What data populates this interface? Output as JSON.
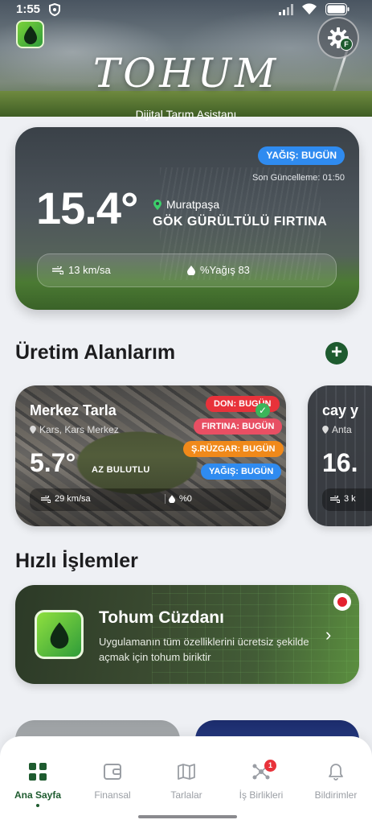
{
  "status_bar": {
    "time": "1:55"
  },
  "header": {
    "brand": "TOHUM",
    "subtitle": "Dijital Tarım Asistanı",
    "settings_badge": "F"
  },
  "weather": {
    "rain_pill": "YAĞIŞ: BUGÜN",
    "last_update": "Son Güncelleme: 01:50",
    "temperature": "15.4°",
    "location": "Muratpaşa",
    "condition": "GÖK GÜRÜLTÜLÜ FIRTINA",
    "wind": "13 km/sa",
    "rain": "%Yağış 83"
  },
  "fields_section": {
    "title": "Üretim Alanlarım"
  },
  "fields": [
    {
      "name": "Merkez Tarla",
      "location": "Kars, Kars Merkez",
      "temperature": "5.7°",
      "condition": "AZ BULUTLU",
      "wind": "29 km/sa",
      "rain": "%0",
      "alerts": [
        "DON: BUGÜN",
        "FIRTINA: BUGÜN",
        "Ş.RÜZGAR: BUGÜN",
        "YAĞIŞ: BUGÜN"
      ]
    },
    {
      "name": "cay y",
      "location": "Anta",
      "temperature": "16.",
      "wind": "3 k"
    }
  ],
  "quick_actions": {
    "title": "Hızlı İşlemler"
  },
  "wallet": {
    "title": "Tohum Cüzdanı",
    "description": "Uygulamanın tüm özelliklerini ücretsiz şekilde açmak için tohum biriktir"
  },
  "nav": {
    "items": [
      {
        "label": "Ana Sayfa",
        "icon": "grid-icon"
      },
      {
        "label": "Finansal",
        "icon": "wallet-icon"
      },
      {
        "label": "Tarlalar",
        "icon": "map-icon"
      },
      {
        "label": "İş Birlikleri",
        "icon": "network-icon"
      },
      {
        "label": "Bildirimler",
        "icon": "bell-icon"
      }
    ],
    "collab_badge": "1"
  },
  "colors": {
    "brand_green": "#1e5b2f",
    "alert_blue": "#2f8bf0",
    "alert_red": "#e8323a",
    "alert_orange": "#f0891a"
  }
}
